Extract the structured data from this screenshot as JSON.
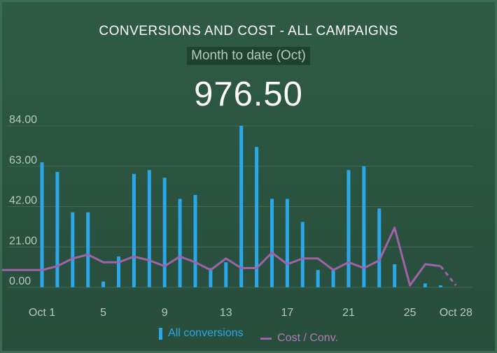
{
  "widget": {
    "title": "CONVERSIONS AND COST - ALL CAMPAIGNS",
    "subtitle": "Month to date (Oct)",
    "value": "976.50"
  },
  "legend": {
    "conversions_label": "All conversions",
    "cost_label": "Cost / Conv."
  },
  "colors": {
    "bars": "#2aa8ea",
    "line": "#a063a8",
    "grid": "#3f6a54",
    "axis_text": "#b9c8bf"
  },
  "chart_data": {
    "type": "bar",
    "ylim": [
      0,
      84
    ],
    "y_ticks": [
      "84.00",
      "63.00",
      "42.00",
      "21.00",
      "0.00"
    ],
    "y_tick_values": [
      84,
      63,
      42,
      21,
      0
    ],
    "x_tick_labels": [
      {
        "day": 1,
        "label": "Oct 1"
      },
      {
        "day": 5,
        "label": "5"
      },
      {
        "day": 9,
        "label": "9"
      },
      {
        "day": 13,
        "label": "13"
      },
      {
        "day": 17,
        "label": "17"
      },
      {
        "day": 21,
        "label": "21"
      },
      {
        "day": 25,
        "label": "25"
      },
      {
        "day": 28,
        "label": "Oct 28"
      }
    ],
    "x": [
      1,
      2,
      3,
      4,
      5,
      6,
      7,
      8,
      9,
      10,
      11,
      12,
      13,
      14,
      15,
      16,
      17,
      18,
      19,
      20,
      21,
      22,
      23,
      24,
      25,
      26,
      27,
      28
    ],
    "series": [
      {
        "name": "All conversions",
        "type": "bar",
        "values": [
          65,
          60,
          39,
          39,
          3,
          16,
          59,
          61,
          57,
          46,
          48,
          10,
          13,
          84,
          73,
          46,
          46,
          34,
          9,
          9,
          61,
          63,
          41,
          12,
          0,
          2,
          1,
          0
        ]
      },
      {
        "name": "Cost / Conv.",
        "type": "line",
        "leading_value": 9,
        "values": [
          9,
          11,
          15,
          17,
          13,
          13,
          16,
          14,
          11,
          16,
          13,
          9,
          15,
          10,
          10,
          18,
          12,
          15,
          15,
          9,
          13,
          10,
          14,
          31,
          1,
          12,
          11,
          1
        ],
        "dashed_from_index": 26
      }
    ]
  }
}
